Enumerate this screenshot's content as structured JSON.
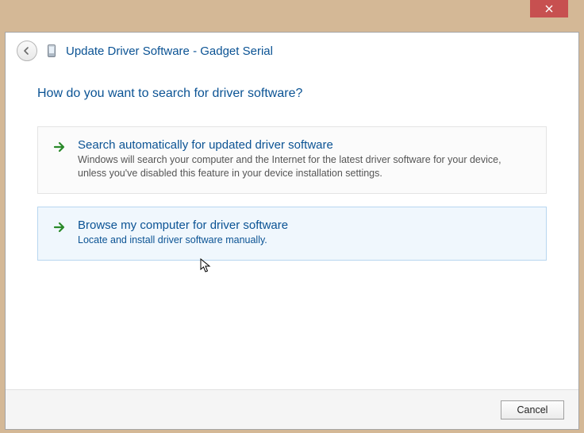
{
  "window": {
    "title": "Update Driver Software - Gadget Serial"
  },
  "heading": "How do you want to search for driver software?",
  "options": [
    {
      "title": "Search automatically for updated driver software",
      "description": "Windows will search your computer and the Internet for the latest driver software for your device, unless you've disabled this feature in your device installation settings."
    },
    {
      "title": "Browse my computer for driver software",
      "description": "Locate and install driver software manually."
    }
  ],
  "footer": {
    "cancel_label": "Cancel"
  }
}
